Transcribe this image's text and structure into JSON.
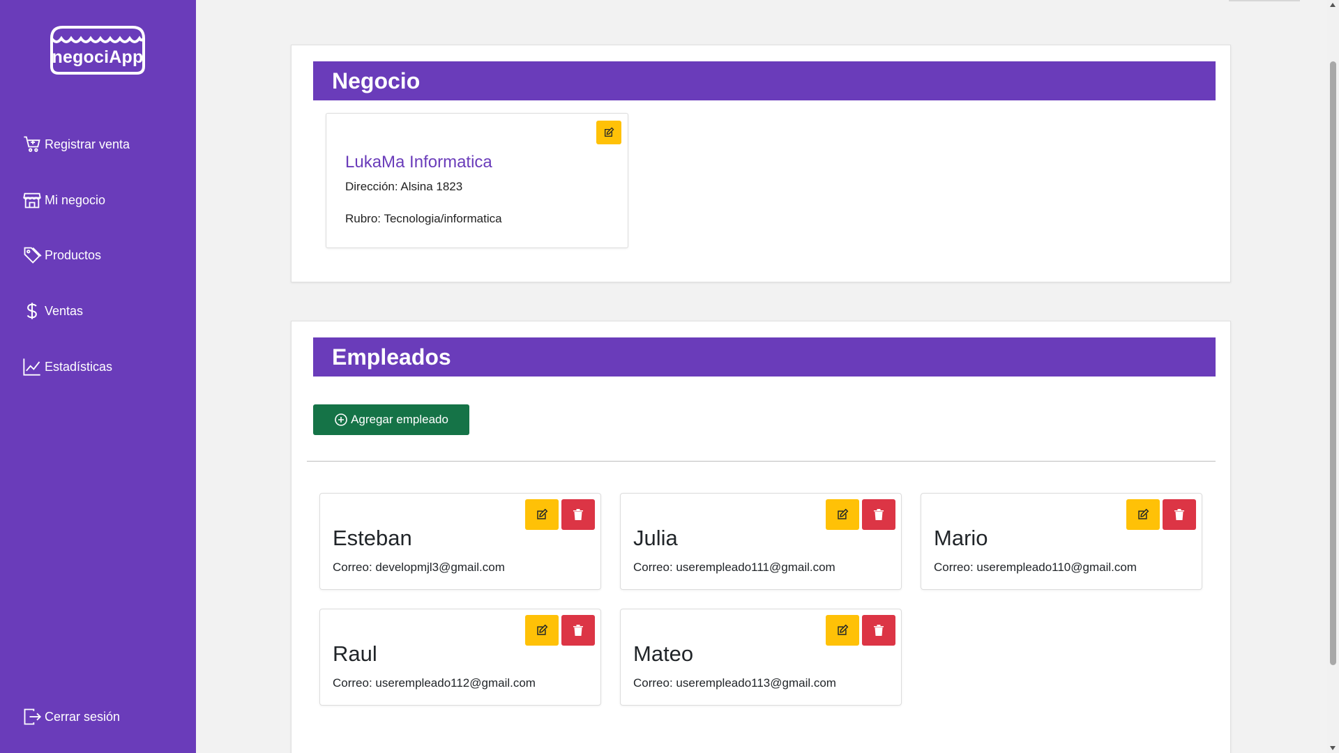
{
  "app": {
    "logo_text": "negociApp",
    "brand_color": "#6a3cba"
  },
  "sidebar": {
    "items": [
      {
        "label": "Registrar venta",
        "icon": "cart-plus-icon"
      },
      {
        "label": "Mi negocio",
        "icon": "shop-icon"
      },
      {
        "label": "Productos",
        "icon": "tags-icon"
      },
      {
        "label": "Ventas",
        "icon": "dollar-icon"
      },
      {
        "label": "Estadísticas",
        "icon": "graph-up-icon"
      }
    ],
    "logout": {
      "label": "Cerrar sesión",
      "icon": "box-arrow-right-icon"
    }
  },
  "negocio": {
    "title": "Negocio",
    "name": "LukaMa Informatica",
    "address": "Dirección: Alsina 1823",
    "category": "Rubro: Tecnologia/informatica"
  },
  "empleados": {
    "title": "Empleados",
    "add_label": "Agregar empleado",
    "list": [
      {
        "name": "Esteban",
        "email": "Correo: developmjl3@gmail.com"
      },
      {
        "name": "Julia",
        "email": "Correo: userempleado111@gmail.com"
      },
      {
        "name": "Mario",
        "email": "Correo: userempleado110@gmail.com"
      },
      {
        "name": "Raul",
        "email": "Correo: userempleado112@gmail.com"
      },
      {
        "name": "Mateo",
        "email": "Correo: userempleado113@gmail.com"
      }
    ]
  },
  "colors": {
    "edit": "#ffc107",
    "delete": "#dc3545",
    "add": "#157347"
  }
}
